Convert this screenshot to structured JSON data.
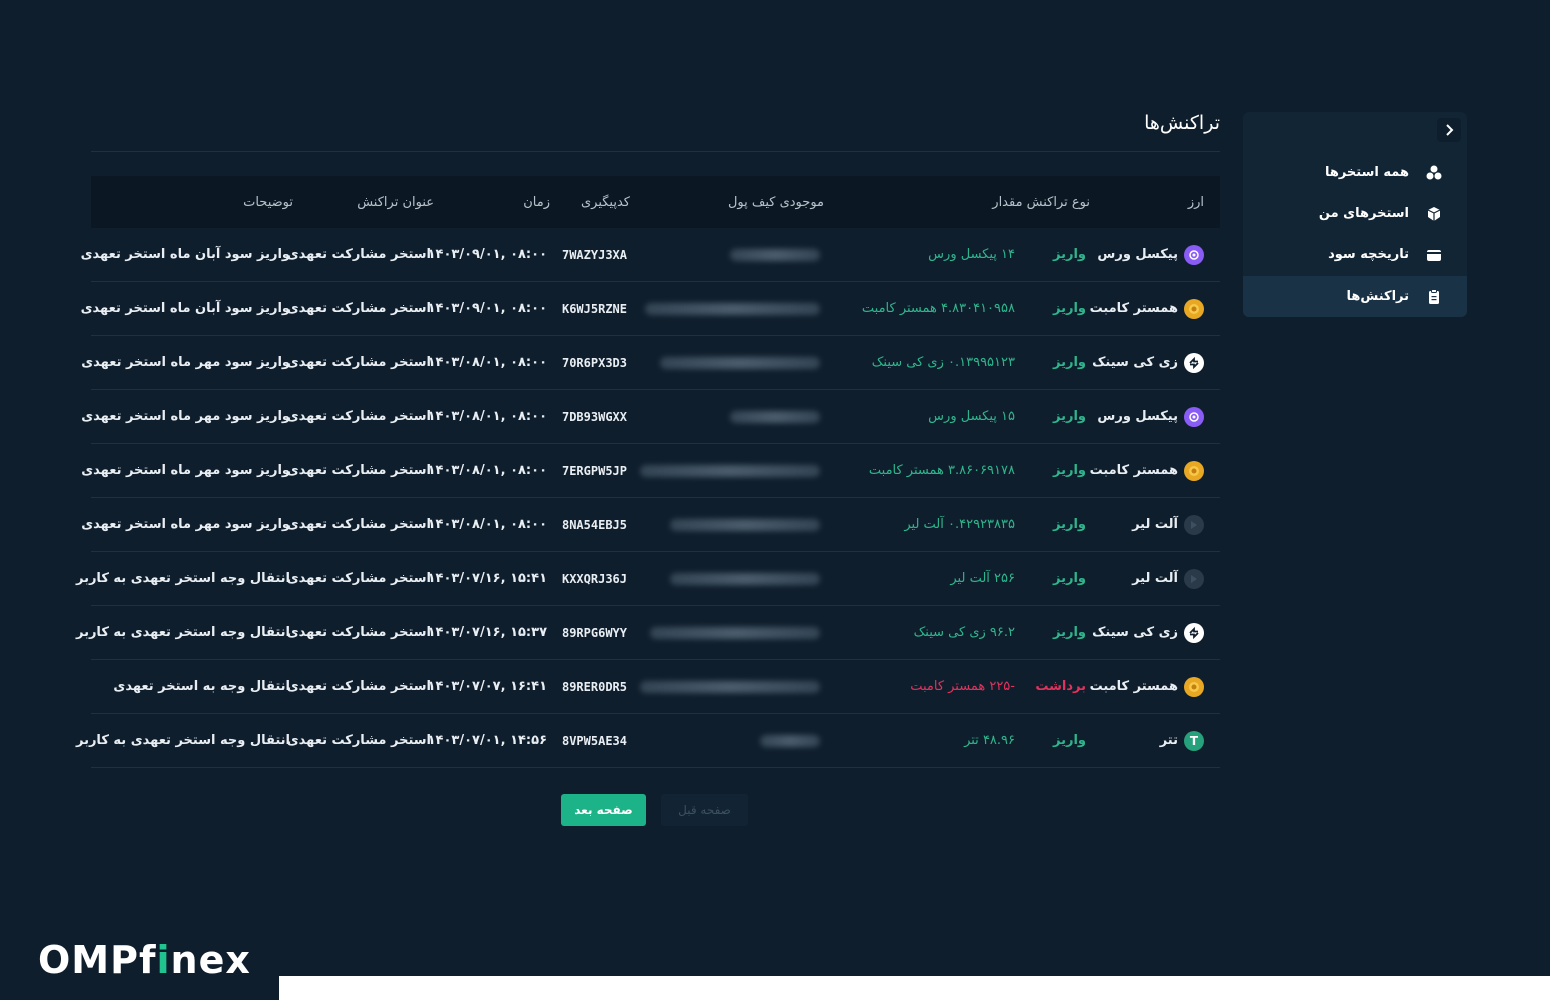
{
  "sidebar": {
    "items": [
      {
        "label": "همه استخرها",
        "icon": "pools-icon",
        "active": false
      },
      {
        "label": "استخرهای من",
        "icon": "box-icon",
        "active": false
      },
      {
        "label": "تاریخچه سود",
        "icon": "wallet-icon",
        "active": false
      },
      {
        "label": "تراکنش‌ها",
        "icon": "clipboard-icon",
        "active": true
      }
    ]
  },
  "page": {
    "title": "تراکنش‌ها"
  },
  "table": {
    "headers": {
      "currency": "ارز",
      "type_amount": "نوع تراکنش مقدار",
      "wallet": "موجودی کیف پول",
      "code": "کدپیگیری",
      "time": "زمان",
      "title": "عنوان تراکنش",
      "description": "توضیحات"
    },
    "rows": [
      {
        "currency": "پیکسل ورس",
        "coin_color": "#8a5cf6",
        "type": "واریز",
        "type_kind": "deposit",
        "amount": "۱۴ پیکسل ورس",
        "code": "7WAZYJ3XA",
        "time": "۰۸:۰۰ ,۱۴۰۳/۰۹/۰۱",
        "title": "استخر مشارکت تعهدی",
        "description": "واریز سود آبان ماه استخر تعهدی"
      },
      {
        "currency": "همستر کامبت",
        "coin_color": "#e8a824",
        "type": "واریز",
        "type_kind": "deposit",
        "amount": "۴.۸۳۰۴۱۰۹۵۸ همستر کامبت",
        "code": "K6WJ5RZNE",
        "time": "۰۸:۰۰ ,۱۴۰۳/۰۹/۰۱",
        "title": "استخر مشارکت تعهدی",
        "description": "واریز سود آبان ماه استخر تعهدی"
      },
      {
        "currency": "زی کی سینک",
        "coin_color": "#ffffff",
        "type": "واریز",
        "type_kind": "deposit",
        "amount": "۰.۱۳۹۹۵۱۲۳ زی کی سینک",
        "code": "70R6PX3D3",
        "time": "۰۸:۰۰ ,۱۴۰۳/۰۸/۰۱",
        "title": "استخر مشارکت تعهدی",
        "description": "واریز سود مهر ماه استخر تعهدی"
      },
      {
        "currency": "پیکسل ورس",
        "coin_color": "#8a5cf6",
        "type": "واریز",
        "type_kind": "deposit",
        "amount": "۱۵ پیکسل ورس",
        "code": "7DB93WGXX",
        "time": "۰۸:۰۰ ,۱۴۰۳/۰۸/۰۱",
        "title": "استخر مشارکت تعهدی",
        "description": "واریز سود مهر ماه استخر تعهدی"
      },
      {
        "currency": "همستر کامبت",
        "coin_color": "#e8a824",
        "type": "واریز",
        "type_kind": "deposit",
        "amount": "۳.۸۶۰۶۹۱۷۸ همستر کامبت",
        "code": "7ERGPW5JP",
        "time": "۰۸:۰۰ ,۱۴۰۳/۰۸/۰۱",
        "title": "استخر مشارکت تعهدی",
        "description": "واریز سود مهر ماه استخر تعهدی"
      },
      {
        "currency": "آلت لیر",
        "coin_color": "#2a3a48",
        "type": "واریز",
        "type_kind": "deposit",
        "amount": "۰.۴۲۹۲۳۸۳۵ آلت لیر",
        "code": "8NA54EBJ5",
        "time": "۰۸:۰۰ ,۱۴۰۳/۰۸/۰۱",
        "title": "استخر مشارکت تعهدی",
        "description": "واریز سود مهر ماه استخر تعهدی"
      },
      {
        "currency": "آلت لیر",
        "coin_color": "#2a3a48",
        "type": "واریز",
        "type_kind": "deposit",
        "amount": "۲۵۶ آلت لیر",
        "code": "KXXQRJ36J",
        "time": "۱۵:۴۱ ,۱۴۰۳/۰۷/۱۶",
        "title": "استخر مشارکت تعهدی",
        "description": "انتقال وجه استخر تعهدی به کاربر"
      },
      {
        "currency": "زی کی سینک",
        "coin_color": "#ffffff",
        "type": "واریز",
        "type_kind": "deposit",
        "amount": "۹۶.۲ زی کی سینک",
        "code": "89RPG6WYY",
        "time": "۱۵:۳۷ ,۱۴۰۳/۰۷/۱۶",
        "title": "استخر مشارکت تعهدی",
        "description": "انتقال وجه استخر تعهدی به کاربر"
      },
      {
        "currency": "همستر کامبت",
        "coin_color": "#e8a824",
        "type": "برداشت",
        "type_kind": "withdraw",
        "amount": "-۲۲۵ همستر کامبت",
        "code": "89RER0DR5",
        "time": "۱۶:۴۱ ,۱۴۰۳/۰۷/۰۷",
        "title": "استخر مشارکت تعهدی",
        "description": "انتقال وجه به استخر تعهدی"
      },
      {
        "currency": "تتر",
        "coin_color": "#26a17b",
        "type": "واریز",
        "type_kind": "deposit",
        "amount": "۴۸.۹۶ تتر",
        "code": "8VPW5AE34",
        "time": "۱۴:۵۶ ,۱۴۰۳/۰۷/۰۱",
        "title": "استخر مشارکت تعهدی",
        "description": "انتقال وجه استخر تعهدی به کاربر"
      }
    ]
  },
  "pagination": {
    "next_label": "صفحه بعد",
    "prev_label": "صفحه قبل"
  },
  "brand": {
    "part1": "OMPf",
    "part2": "i",
    "part3": "nex"
  },
  "colors": {
    "background": "#0f1e2c",
    "accent": "#1db388",
    "deposit": "#2fb58c",
    "withdraw": "#e0335c"
  }
}
